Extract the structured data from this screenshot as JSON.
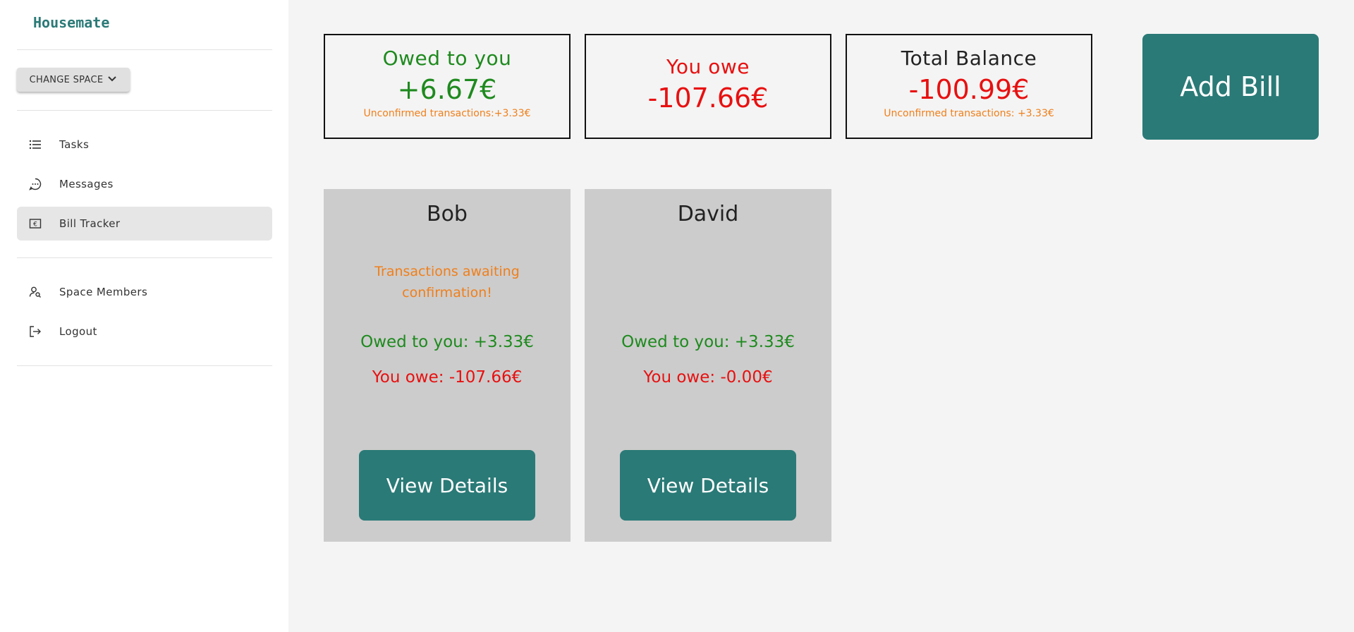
{
  "sidebar": {
    "brand": "Housemate",
    "change_space_label": "CHANGE SPACE",
    "items": [
      {
        "label": "Tasks",
        "icon": "list-icon"
      },
      {
        "label": "Messages",
        "icon": "chat-bubble-icon"
      },
      {
        "label": "Bill Tracker",
        "icon": "euro-bill-icon",
        "active": true
      },
      {
        "label": "Space Members",
        "icon": "user-search-icon"
      },
      {
        "label": "Logout",
        "icon": "logout-icon"
      }
    ]
  },
  "summary": {
    "owed": {
      "title": "Owed to you",
      "amount": "+6.67€",
      "note": "Unconfirmed transactions:+3.33€"
    },
    "owe": {
      "title": "You owe",
      "amount": "-107.66€"
    },
    "total": {
      "title": "Total Balance",
      "amount": "-100.99€",
      "note": "Unconfirmed transactions: +3.33€"
    }
  },
  "add_bill_label": "Add Bill",
  "members": [
    {
      "name": "Bob",
      "awaiting": "Transactions awaiting confirmation!",
      "owed": "Owed to you: +3.33€",
      "owe": "You owe: -107.66€",
      "button": "View Details"
    },
    {
      "name": "David",
      "awaiting": "",
      "owed": "Owed to you: +3.33€",
      "owe": "You owe: -0.00€",
      "button": "View Details"
    }
  ],
  "colors": {
    "accent": "#2a7a77",
    "positive": "#1e8a1e",
    "negative": "#e81010",
    "warning": "#f07f1a"
  }
}
